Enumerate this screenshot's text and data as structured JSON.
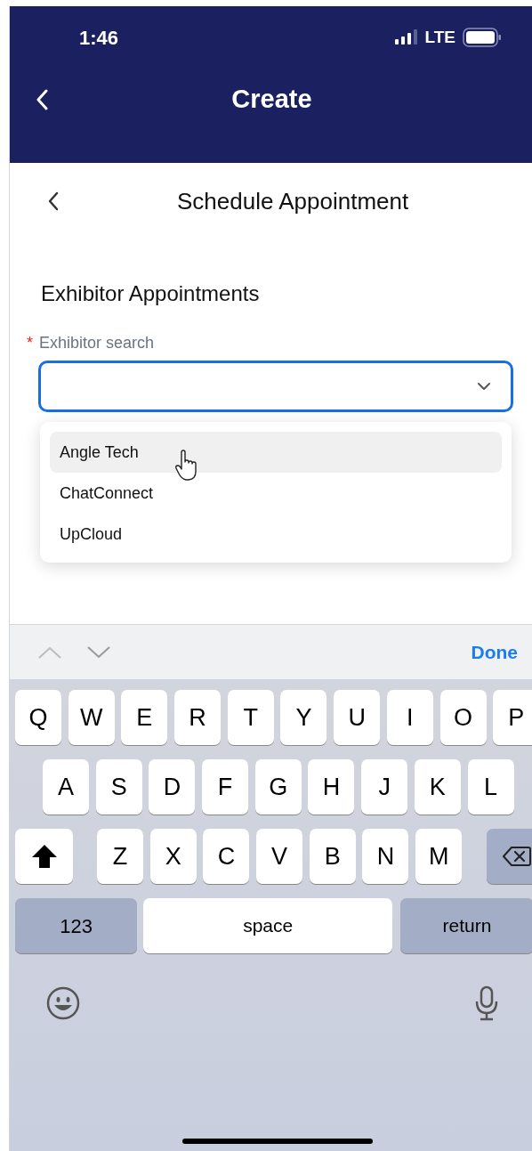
{
  "status_bar": {
    "time": "1:46",
    "network": "LTE"
  },
  "nav_bar": {
    "title": "Create"
  },
  "page": {
    "title": "Schedule Appointment"
  },
  "section": {
    "title": "Exhibitor Appointments"
  },
  "field": {
    "label": "Exhibitor search",
    "required_marker": "*",
    "focused": true
  },
  "options": [
    {
      "label": "Angle Tech",
      "selected": true
    },
    {
      "label": "ChatConnect",
      "selected": false
    },
    {
      "label": "UpCloud",
      "selected": false
    }
  ],
  "keyboard_toolbar": {
    "done": "Done"
  },
  "keyboard": {
    "rows": [
      [
        "Q",
        "W",
        "E",
        "R",
        "T",
        "Y",
        "U",
        "I",
        "O",
        "P"
      ],
      [
        "A",
        "S",
        "D",
        "F",
        "G",
        "H",
        "J",
        "K",
        "L"
      ],
      [
        "Z",
        "X",
        "C",
        "V",
        "B",
        "N",
        "M"
      ]
    ],
    "numbers_key": "123",
    "space_key": "space",
    "return_key": "return"
  }
}
